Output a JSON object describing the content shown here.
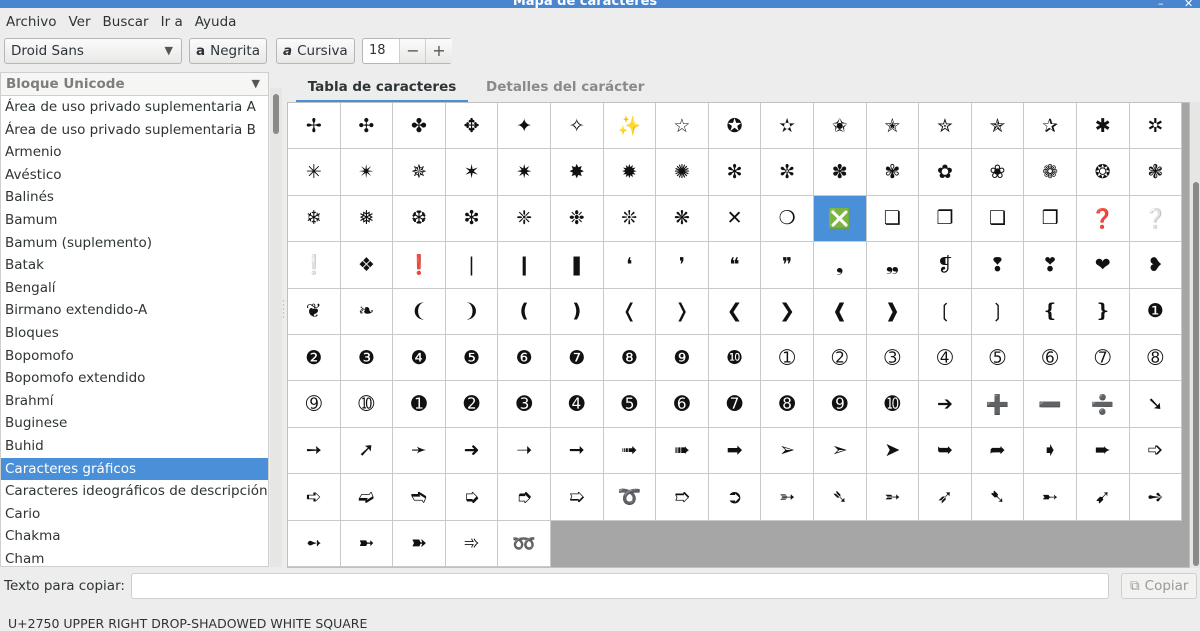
{
  "window": {
    "title": "Mapa de caracteres"
  },
  "menubar": {
    "items": [
      "Archivo",
      "Ver",
      "Buscar",
      "Ir a",
      "Ayuda"
    ]
  },
  "toolbar": {
    "font": "Droid Sans",
    "bold_label": "Negrita",
    "italic_label": "Cursiva",
    "bold_icon": "a",
    "italic_icon": "a",
    "size": "18",
    "minus": "−",
    "plus": "+"
  },
  "sidebar": {
    "combo_label": "Bloque Unicode",
    "selected_index": 17,
    "items": [
      "Área de uso privado suplementaria A",
      "Área de uso privado suplementaria B",
      "Armenio",
      "Avéstico",
      "Balinés",
      "Bamum",
      "Bamum (suplemento)",
      "Batak",
      "Bengalí",
      "Birmano extendido-A",
      "Bloques",
      "Bopomofo",
      "Bopomofo extendido",
      "Brahmí",
      "Buginese",
      "Buhid",
      "Caracteres gráficos",
      "Caracteres ideográficos de descripción",
      "Cario",
      "Chakma",
      "Cham"
    ]
  },
  "tabs": {
    "table": "Tabla de caracteres",
    "details": "Detalles del carácter"
  },
  "grid": {
    "selected_index": 44,
    "chars": [
      "✢",
      "✣",
      "✤",
      "✥",
      "✦",
      "✧",
      "✨",
      "☆",
      "✪",
      "✫",
      "✬",
      "✭",
      "✮",
      "✯",
      "✰",
      "✱",
      "✲",
      "✳",
      "✴",
      "✵",
      "✶",
      "✷",
      "✸",
      "✹",
      "✺",
      "✻",
      "✼",
      "✽",
      "✾",
      "✿",
      "❀",
      "❁",
      "❂",
      "❃",
      "❄",
      "❅",
      "❆",
      "❇",
      "❈",
      "❉",
      "❊",
      "❋",
      "✕",
      "❍",
      "❎",
      "❏",
      "❐",
      "❑",
      "❒",
      "❓",
      "❔",
      "❕",
      "❖",
      "❗",
      "❘",
      "❙",
      "❚",
      "❛",
      "❜",
      "❝",
      "❞",
      "❟",
      "❠",
      "❡",
      "❢",
      "❣",
      "❤",
      "❥",
      "❦",
      "❧",
      "❨",
      "❩",
      "❪",
      "❫",
      "❬",
      "❭",
      "❮",
      "❯",
      "❰",
      "❱",
      "❲",
      "❳",
      "❴",
      "❵",
      "❶",
      "❷",
      "❸",
      "❹",
      "❺",
      "❻",
      "❼",
      "❽",
      "❾",
      "❿",
      "➀",
      "➁",
      "➂",
      "➃",
      "➄",
      "➅",
      "➆",
      "➇",
      "➈",
      "➉",
      "➊",
      "➋",
      "➌",
      "➍",
      "➎",
      "➏",
      "➐",
      "➑",
      "➒",
      "➓",
      "➔",
      "➕",
      "➖",
      "➗",
      "➘",
      "➙",
      "➚",
      "➛",
      "➜",
      "➝",
      "➞",
      "➟",
      "➠",
      "➡",
      "➢",
      "➣",
      "➤",
      "➥",
      "➦",
      "➧",
      "➨",
      "➩",
      "➪",
      "➫",
      "➬",
      "➭",
      "➮",
      "➯",
      "➰",
      "➱",
      "➲",
      "➳",
      "➴",
      "➵",
      "➶",
      "➷",
      "➸",
      "➹",
      "➺",
      "➻",
      "➼",
      "➽",
      "➾",
      "➿"
    ]
  },
  "copy": {
    "label": "Texto para copiar:",
    "value": "",
    "button": "Copiar",
    "button_icon": "⧉"
  },
  "status": {
    "text": "U+2750 UPPER RIGHT DROP-SHADOWED WHITE SQUARE"
  },
  "colors": {
    "selection": "#4a90d9",
    "titlebar": "#4a86cf",
    "grid_empty": "#a6a6a6"
  }
}
